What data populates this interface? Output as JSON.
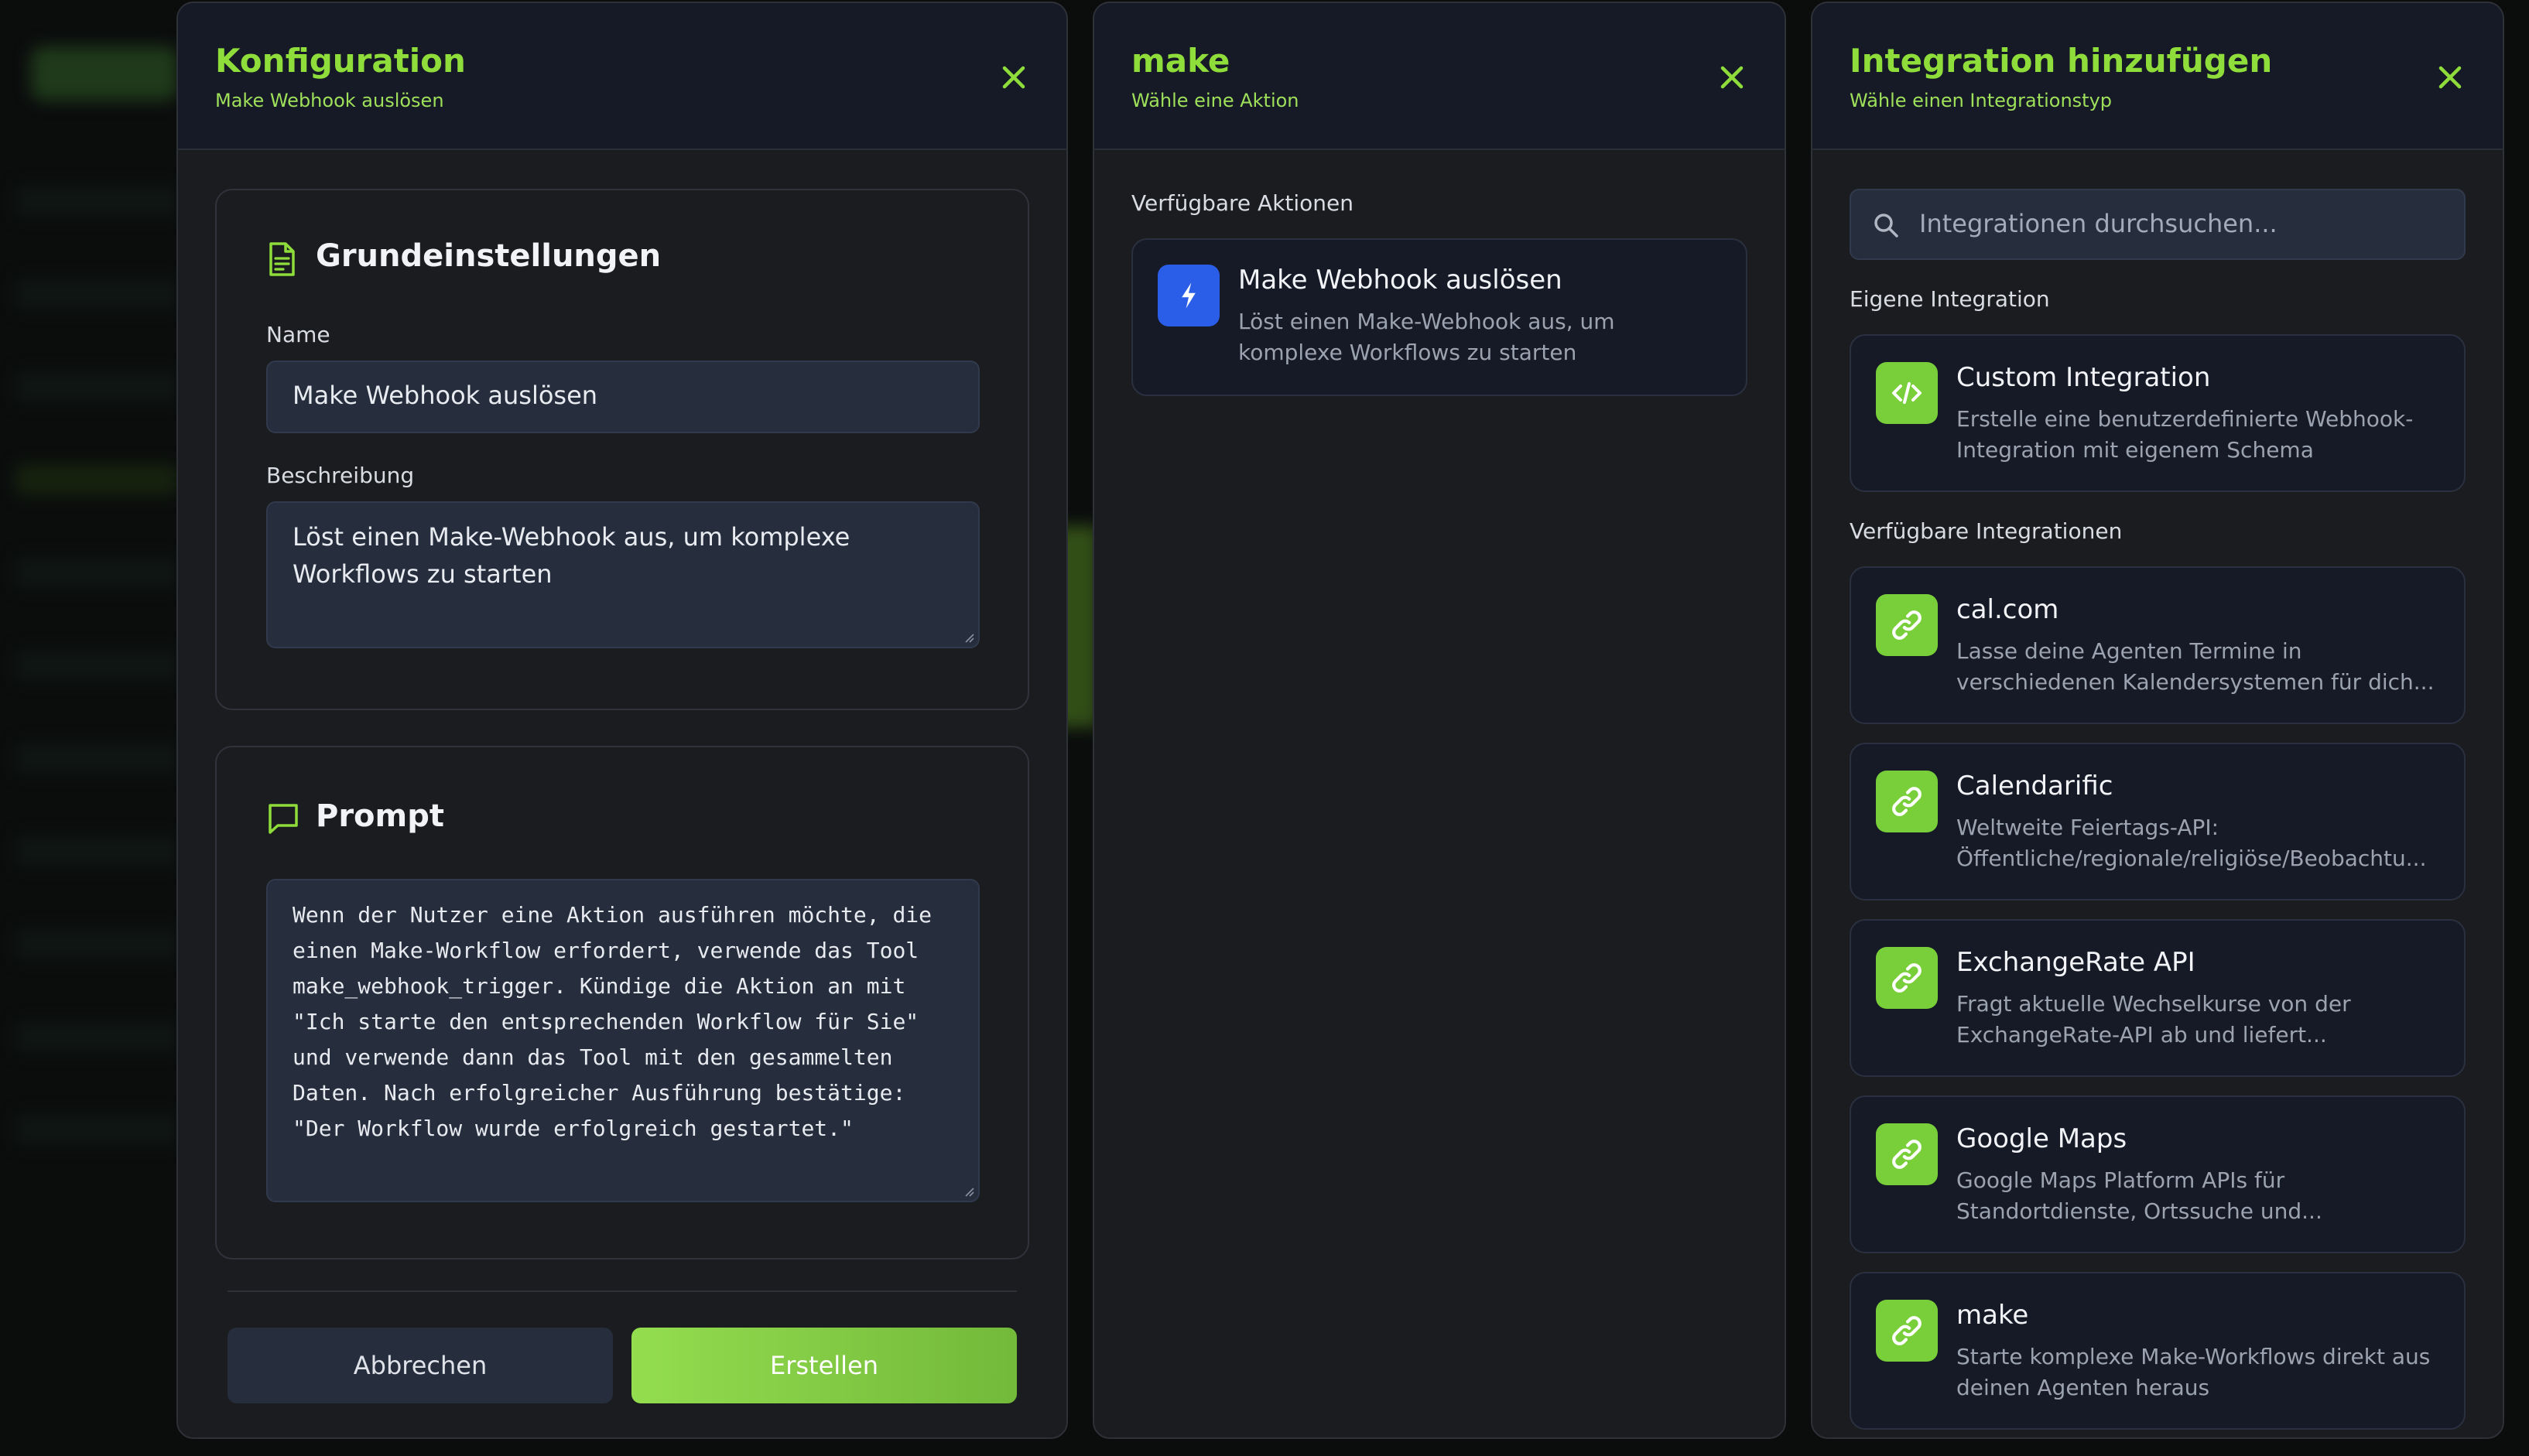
{
  "colors": {
    "accent": "#8fdd3a",
    "primary_button": "#8ad14a",
    "blue_icon": "#2b5ee8"
  },
  "config_panel": {
    "title": "Konfiguration",
    "subtitle": "Make Webhook auslösen",
    "basic": {
      "title": "Grundeinstellungen",
      "name_label": "Name",
      "name_value": "Make Webhook auslösen",
      "desc_label": "Beschreibung",
      "desc_lines": [
        "Löst einen Make-Webhook aus, um komplexe",
        "Workflows zu starten"
      ]
    },
    "prompt": {
      "title": "Prompt",
      "lines": [
        "Wenn der Nutzer eine Aktion ausführen möchte, die",
        "einen Make-Workflow erfordert, verwende das Tool",
        "make_webhook_trigger. Kündige die Aktion an mit",
        "\"Ich starte den entsprechenden Workflow für Sie\"",
        "und verwende dann das Tool mit den gesammelten",
        "Daten. Nach erfolgreicher Ausführung bestätige:",
        "\"Der Workflow wurde erfolgreich gestartet.\""
      ]
    },
    "cancel_label": "Abbrechen",
    "create_label": "Erstellen"
  },
  "make_panel": {
    "title": "make",
    "subtitle": "Wähle eine Aktion",
    "section_label": "Verfügbare Aktionen",
    "action": {
      "title": "Make Webhook auslösen",
      "desc_lines": [
        "Löst einen Make-Webhook aus, um",
        "komplexe Workflows zu starten"
      ],
      "icon": "lightning-icon"
    }
  },
  "integration_panel": {
    "title": "Integration hinzufügen",
    "subtitle": "Wähle einen Integrationstyp",
    "search_placeholder": "Integrationen durchsuchen...",
    "own_label": "Eigene Integration",
    "custom": {
      "title": "Custom Integration",
      "desc_lines": [
        "Erstelle eine benutzerdefinierte Webhook-",
        "Integration mit eigenem Schema"
      ],
      "icon": "code-icon"
    },
    "available_label": "Verfügbare Integrationen",
    "items": [
      {
        "title": "cal.com",
        "desc_lines": [
          "Lasse deine Agenten Termine in",
          "verschiedenen Kalendersystemen für dich..."
        ],
        "icon": "link-icon"
      },
      {
        "title": "Calendarific",
        "desc_lines": [
          "Weltweite Feiertags-API:",
          "Öffentliche/regionale/religiöse/Beobachtu..."
        ],
        "icon": "link-icon"
      },
      {
        "title": "ExchangeRate API",
        "desc_lines": [
          "Fragt aktuelle Wechselkurse von der",
          "ExchangeRate-API ab und liefert..."
        ],
        "icon": "link-icon"
      },
      {
        "title": "Google Maps",
        "desc_lines": [
          "Google Maps Platform APIs für",
          "Standortdienste, Ortssuche und..."
        ],
        "icon": "link-icon"
      },
      {
        "title": "make",
        "desc_lines": [
          "Starte komplexe Make-Workflows direkt aus",
          "deinen Agenten heraus"
        ],
        "icon": "link-icon"
      }
    ]
  }
}
